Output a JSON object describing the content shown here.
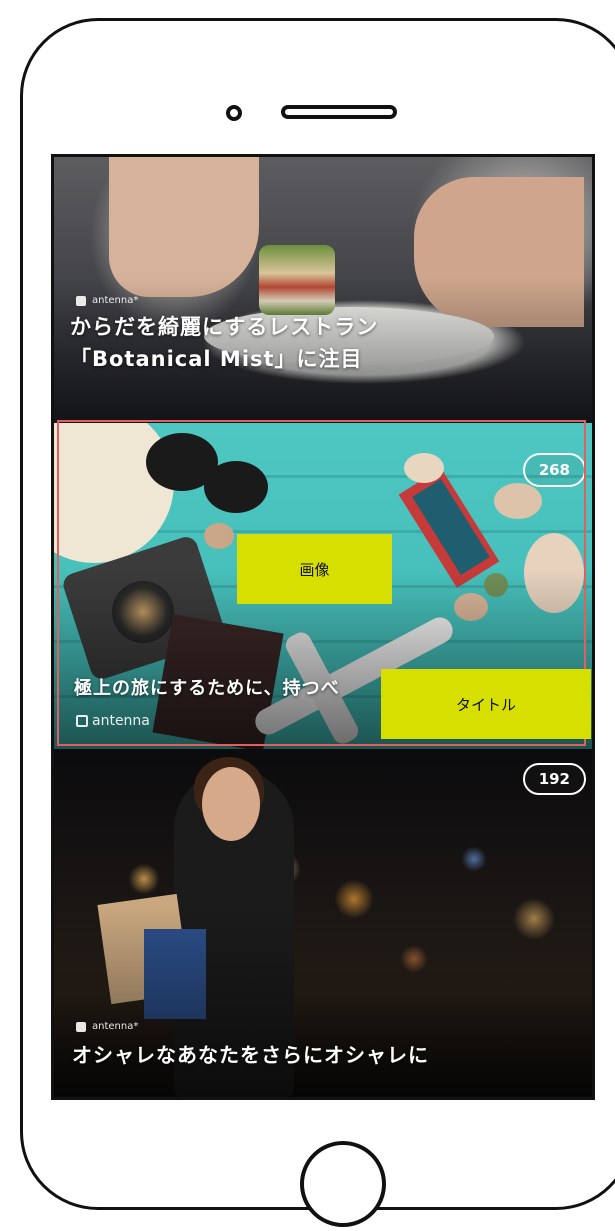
{
  "feed": {
    "cards": [
      {
        "brand": "antenna*",
        "title_line1": "からだを綺麗にするレストラン",
        "title_line2": "「Botanical Mist」に注目"
      },
      {
        "title": "極上の旅にするために、持つべ",
        "brand": "antenna",
        "count": "268"
      },
      {
        "brand": "antenna*",
        "title": "オシャレなあなたをさらにオシャレに",
        "count": "192"
      }
    ]
  },
  "annotations": {
    "image_label": "画像",
    "title_label": "タイトル",
    "frame_color": "#e0605f",
    "label_color": "#d7df01"
  },
  "icons": [
    "camera-icon",
    "speaker-icon",
    "home-button-icon",
    "antenna-logo-icon"
  ]
}
